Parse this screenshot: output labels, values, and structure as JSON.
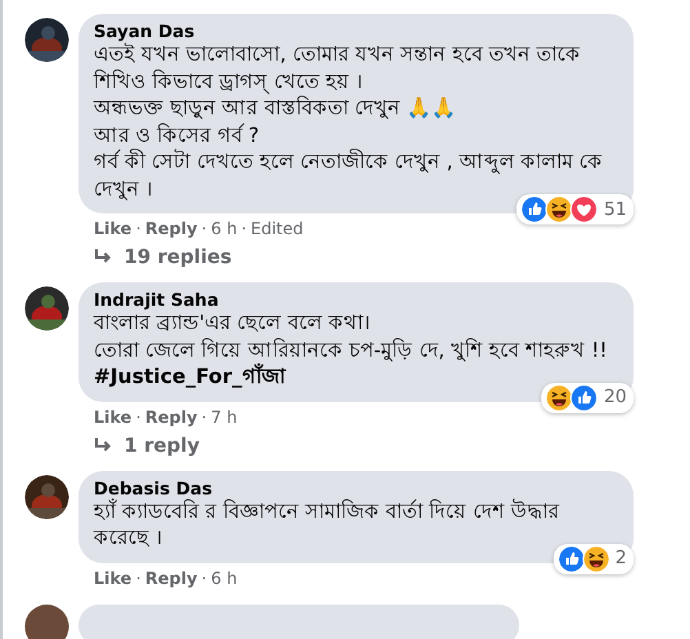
{
  "comments": [
    {
      "author": "Sayan Das",
      "paragraphs": [
        "এতই যখন ভালোবাসো, তোমার যখন সন্তান হবে তখন তাকে শিখিও কিভাবে ড্রাগস্ খেতে হয় ।",
        "অন্ধভক্ত ছাড়ুন আর বাস্তবিকতা দেখুন 🙏🙏",
        "আর ও কিসের গর্ব ?",
        "গর্ব কী সেটা দেখতে হলে নেতাজীকে দেখুন , আব্দুল কালাম কে দেখুন ।"
      ],
      "reactions": [
        {
          "kind": "like"
        },
        {
          "kind": "haha"
        },
        {
          "kind": "love"
        }
      ],
      "reaction_count": "51",
      "meta": [
        {
          "kind": "link",
          "text": "Like"
        },
        {
          "kind": "sep",
          "text": "·"
        },
        {
          "kind": "link",
          "text": "Reply"
        },
        {
          "kind": "sep",
          "text": "·"
        },
        {
          "kind": "time",
          "text": "6 h"
        },
        {
          "kind": "sep",
          "text": "·"
        },
        {
          "kind": "note",
          "text": "Edited"
        }
      ],
      "replies": "19 replies"
    },
    {
      "author": "Indrajit Saha",
      "paragraphs": [
        "বাংলার ব্র্যান্ড'এর ছেলে বলে কথা।",
        "তোরা জেলে গিয়ে আরিয়ানকে চপ-মুড়ি দে, খুশি হবে শাহরুখ !!",
        "**#Justice_For_গাঁজা**"
      ],
      "reactions": [
        {
          "kind": "haha"
        },
        {
          "kind": "like"
        }
      ],
      "reaction_count": "20",
      "meta": [
        {
          "kind": "link",
          "text": "Like"
        },
        {
          "kind": "sep",
          "text": "·"
        },
        {
          "kind": "link",
          "text": "Reply"
        },
        {
          "kind": "sep",
          "text": "·"
        },
        {
          "kind": "time",
          "text": "7 h"
        }
      ],
      "replies": "1 reply"
    },
    {
      "author": "Debasis Das",
      "paragraphs": [
        "হ্যাঁ ক্যাডবেরি র বিজ্ঞাপনে সামাজিক বার্তা দিয়ে দেশ উদ্ধার করেছে ।"
      ],
      "reactions": [
        {
          "kind": "like"
        },
        {
          "kind": "haha"
        }
      ],
      "reaction_count": "2",
      "meta": [
        {
          "kind": "link",
          "text": "Like"
        },
        {
          "kind": "sep",
          "text": "·"
        },
        {
          "kind": "link",
          "text": "Reply"
        },
        {
          "kind": "sep",
          "text": "·"
        },
        {
          "kind": "time",
          "text": "6 h"
        }
      ]
    }
  ]
}
